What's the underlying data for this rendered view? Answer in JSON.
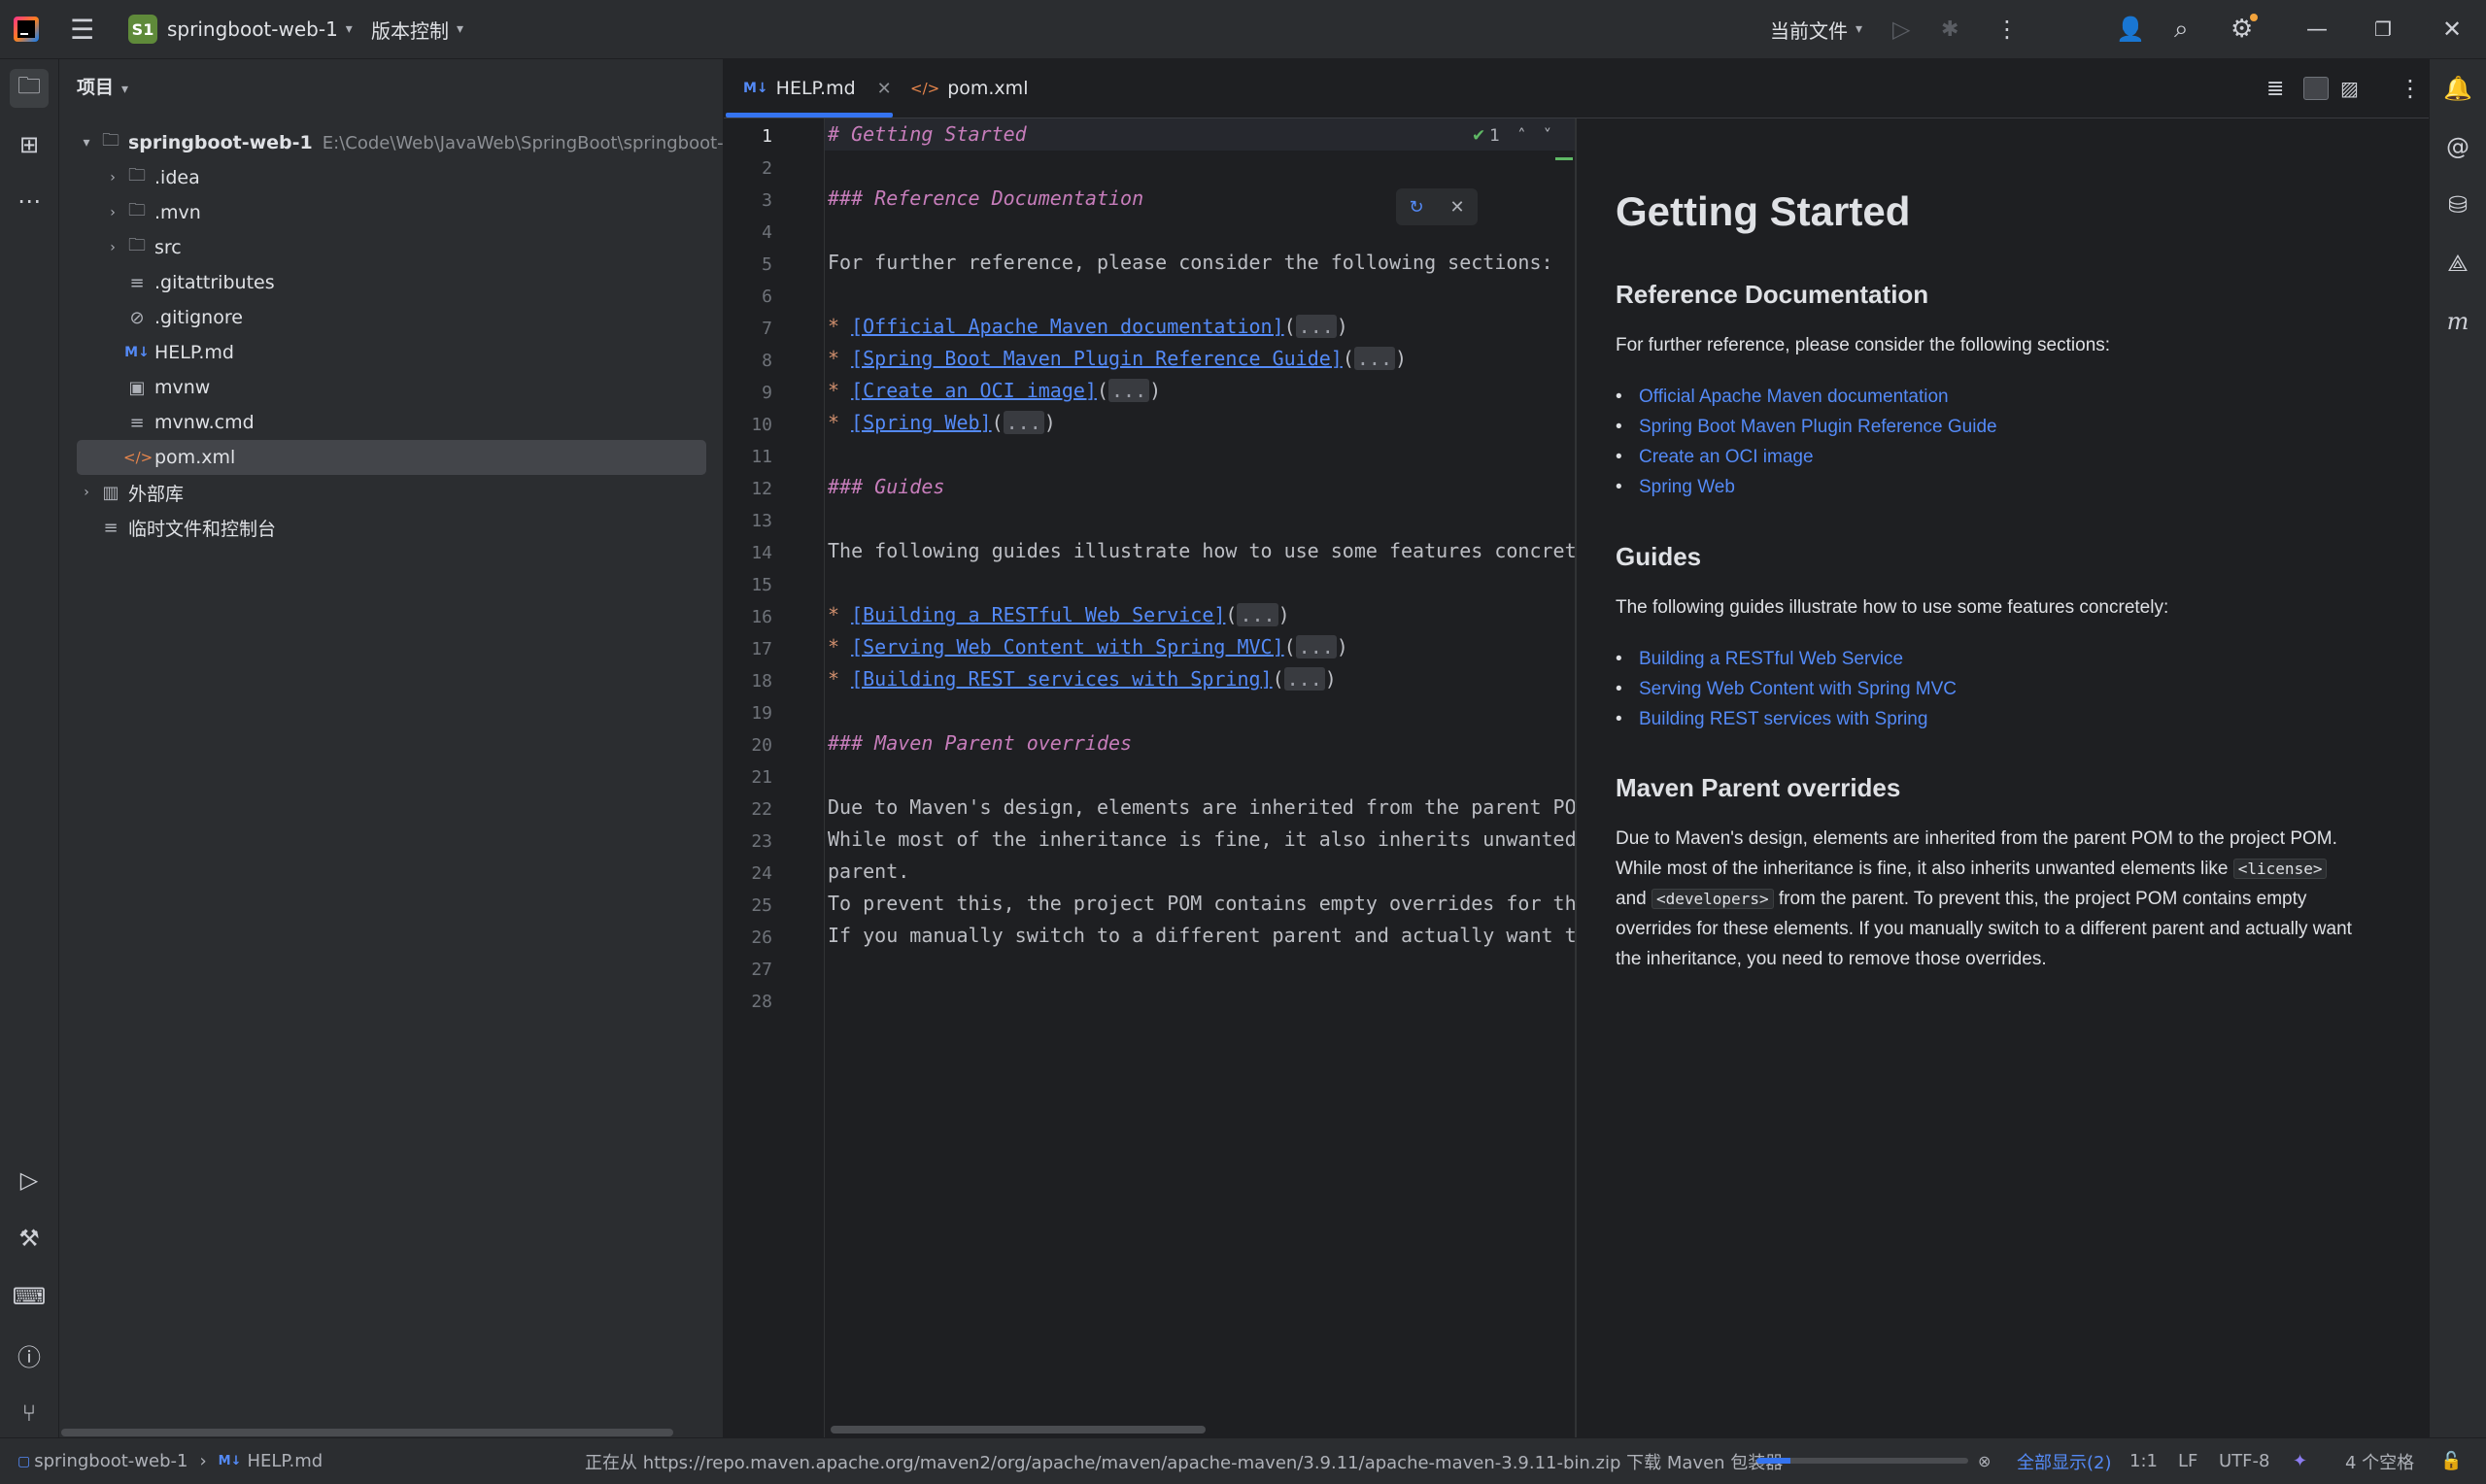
{
  "titlebar": {
    "project_badge": "S1",
    "project_name": "springboot-web-1",
    "vcs_label": "版本控制",
    "run_config": "当前文件",
    "icons": [
      "app-logo-icon",
      "hamburger-menu-icon",
      "run-icon",
      "debug-icon",
      "more-icon",
      "add-user-icon",
      "search-icon",
      "settings-icon",
      "minimize-icon",
      "restore-icon",
      "close-icon"
    ]
  },
  "project_panel": {
    "title": "项目",
    "root_name": "springboot-web-1",
    "root_path": "E:\\Code\\Web\\JavaWeb\\SpringBoot\\springboot-we",
    "items": [
      {
        "label": ".idea",
        "icon": "folder-icon"
      },
      {
        "label": ".mvn",
        "icon": "folder-icon"
      },
      {
        "label": "src",
        "icon": "folder-icon"
      },
      {
        "label": ".gitattributes",
        "icon": "text-file-icon"
      },
      {
        "label": ".gitignore",
        "icon": "ignore-file-icon"
      },
      {
        "label": "HELP.md",
        "icon": "markdown-icon"
      },
      {
        "label": "mvnw",
        "icon": "shell-icon"
      },
      {
        "label": "mvnw.cmd",
        "icon": "text-file-icon"
      },
      {
        "label": "pom.xml",
        "icon": "xml-icon"
      }
    ],
    "external_libs": "外部库",
    "scratches": "临时文件和控制台"
  },
  "tabs": [
    {
      "label": "HELP.md",
      "icon": "markdown-icon",
      "active": true
    },
    {
      "label": "pom.xml",
      "icon": "xml-icon",
      "active": false
    }
  ],
  "editor": {
    "inspection_count": "1",
    "fold_ellipsis": "...",
    "line_numbers": [
      "1",
      "2",
      "3",
      "4",
      "5",
      "6",
      "7",
      "8",
      "9",
      "10",
      "11",
      "12",
      "13",
      "14",
      "15",
      "16",
      "17",
      "18",
      "19",
      "20",
      "21",
      "22",
      "23",
      "24",
      "25",
      "26",
      "27",
      "28"
    ],
    "l1": "# Getting Started",
    "l3": "### Reference Documentation",
    "l5": "For further reference, please consider the following sections:",
    "l7": "[Official Apache Maven documentation]",
    "l8": "[Spring Boot Maven Plugin Reference Guide]",
    "l9": "[Create an OCI image]",
    "l10": "[Spring Web]",
    "l12": "### Guides",
    "l14": "The following guides illustrate how to use some features concrete",
    "l16": "[Building a RESTful Web Service]",
    "l17": "[Serving Web Content with Spring MVC]",
    "l18": "[Building REST services with Spring]",
    "l20": "### Maven Parent overrides",
    "l22": "Due to Maven's design, elements are inherited from the parent POM",
    "l23": "While most of the inheritance is fine, it also inherits unwanted",
    "l24": "parent.",
    "l25": "To prevent this, the project POM contains empty overrides for the",
    "l26": "If you manually switch to a different parent and actually want th"
  },
  "preview": {
    "h1": "Getting Started",
    "h_ref": "Reference Documentation",
    "p_ref": "For further reference, please consider the following sections:",
    "ref_links": [
      "Official Apache Maven documentation",
      "Spring Boot Maven Plugin Reference Guide",
      "Create an OCI image",
      "Spring Web"
    ],
    "h_guides": "Guides",
    "p_guides": "The following guides illustrate how to use some features concretely:",
    "guide_links": [
      "Building a RESTful Web Service",
      "Serving Web Content with Spring MVC",
      "Building REST services with Spring"
    ],
    "h_maven": "Maven Parent overrides",
    "p_maven_1": "Due to Maven's design, elements are inherited from the parent POM to the project POM.",
    "p_maven_2a": "While most of the inheritance is fine, it also inherits unwanted elements like",
    "code_license": "<license>",
    "p_maven_3a": "and",
    "code_developers": "<developers>",
    "p_maven_3b": "from the parent. To prevent this, the project POM contains empty",
    "p_maven_4": "overrides for these elements. If you manually switch to a different parent and actually want",
    "p_maven_5": "the inheritance, you need to remove those overrides."
  },
  "statusbar": {
    "breadcrumb_project": "springboot-web-1",
    "breadcrumb_file": "HELP.md",
    "progress_text": "正在从 https://repo.maven.apache.org/maven2/org/apache/maven/apache-maven/3.9.11/apache-maven-3.9.11-bin.zip 下载 Maven 包装器",
    "progress_value": 0.16,
    "show_all": "全部显示(2)",
    "position": "1:1",
    "line_sep": "LF",
    "encoding": "UTF-8",
    "indent": "4 个空格"
  },
  "colors": {
    "accent": "#3574f0",
    "link": "#548af7",
    "heading_md": "#c77dbb"
  }
}
